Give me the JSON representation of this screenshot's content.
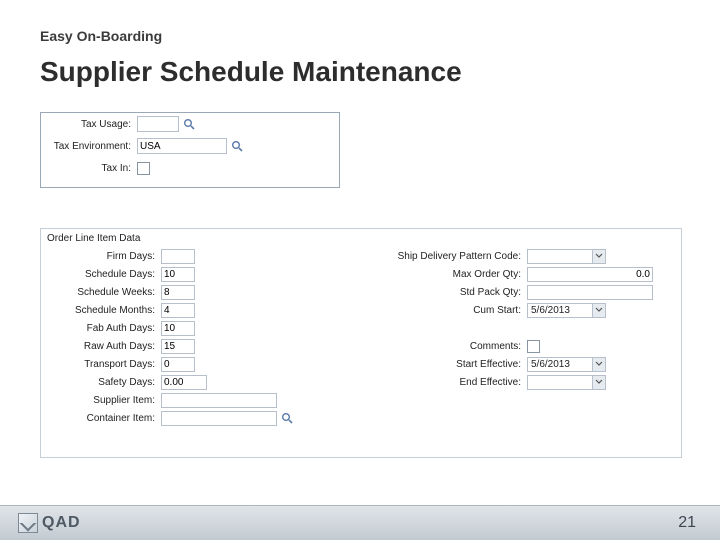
{
  "header": {
    "eyebrow": "Easy On-Boarding",
    "title": "Supplier Schedule Maintenance"
  },
  "tax": {
    "taxUsage": {
      "label": "Tax Usage:",
      "value": ""
    },
    "taxEnvironment": {
      "label": "Tax Environment:",
      "value": "USA"
    },
    "taxIn": {
      "label": "Tax In:"
    }
  },
  "order": {
    "heading": "Order Line Item Data",
    "left": {
      "firmDays": {
        "label": "Firm Days:",
        "value": ""
      },
      "scheduleDays": {
        "label": "Schedule Days:",
        "value": "10"
      },
      "scheduleWeeks": {
        "label": "Schedule Weeks:",
        "value": "8"
      },
      "scheduleMonths": {
        "label": "Schedule Months:",
        "value": "4"
      },
      "fabAuthDays": {
        "label": "Fab Auth Days:",
        "value": "10"
      },
      "rawAuthDays": {
        "label": "Raw Auth Days:",
        "value": "15"
      },
      "transportDays": {
        "label": "Transport Days:",
        "value": "0"
      },
      "safetyDays": {
        "label": "Safety Days:",
        "value": "0.00"
      },
      "supplierItem": {
        "label": "Supplier Item:",
        "value": ""
      },
      "containerItem": {
        "label": "Container Item:",
        "value": ""
      }
    },
    "right": {
      "shipPattern": {
        "label": "Ship Delivery Pattern Code:",
        "value": ""
      },
      "maxOrderQty": {
        "label": "Max Order Qty:",
        "value": "0.0"
      },
      "stdPackQty": {
        "label": "Std Pack Qty:",
        "value": ""
      },
      "cumStart": {
        "label": "Cum Start:",
        "value": "5/6/2013"
      },
      "blank1": {
        "label": "",
        "value": ""
      },
      "comments": {
        "label": "Comments:"
      },
      "startEffective": {
        "label": "Start Effective:",
        "value": "5/6/2013"
      },
      "endEffective": {
        "label": "End Effective:",
        "value": ""
      }
    }
  },
  "footer": {
    "logoText": "QAD",
    "pageNumber": "21"
  }
}
